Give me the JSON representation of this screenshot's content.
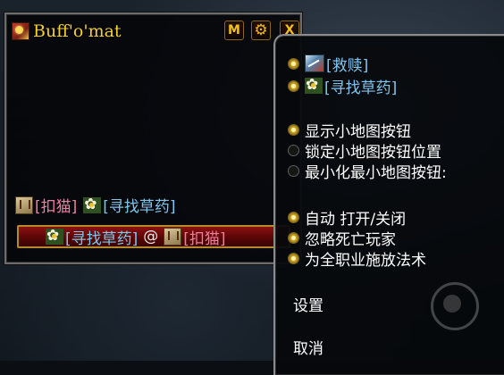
{
  "frame": {
    "title": "Buff'o'mat",
    "buttons": {
      "minimap_label": "M",
      "close_label": "X"
    },
    "buff_line": {
      "spell1": {
        "text": "扣猫",
        "color": "#ef7fa0"
      },
      "spell2": {
        "text": "寻找草药",
        "color": "#7fc6ee"
      }
    },
    "cast_bar": {
      "spell": "寻找草药",
      "at": "@",
      "target": "扣猫"
    }
  },
  "menu": {
    "spells": [
      {
        "label": "救赎",
        "checked": true,
        "icon": "redemption-icon"
      },
      {
        "label": "寻找草药",
        "checked": true,
        "icon": "flower-icon"
      }
    ],
    "minimap_options": [
      {
        "label": "显示小地图按钮",
        "checked": true
      },
      {
        "label": "锁定小地图按钮位置",
        "checked": false
      },
      {
        "label": "最小化最小地图按钮:",
        "checked": false
      }
    ],
    "behavior_options": [
      {
        "label": "自动 打开/关闭",
        "checked": true
      },
      {
        "label": "忽略死亡玩家",
        "checked": true
      },
      {
        "label": "为全职业施放法术",
        "checked": true
      }
    ],
    "settings_label": "设置",
    "cancel_label": "取消"
  },
  "colors": {
    "title_gold": "#f3cf2f",
    "spell_red": "#ef7fa0",
    "spell_blue": "#7fc6ee",
    "cast_bar": "#8c1010"
  }
}
